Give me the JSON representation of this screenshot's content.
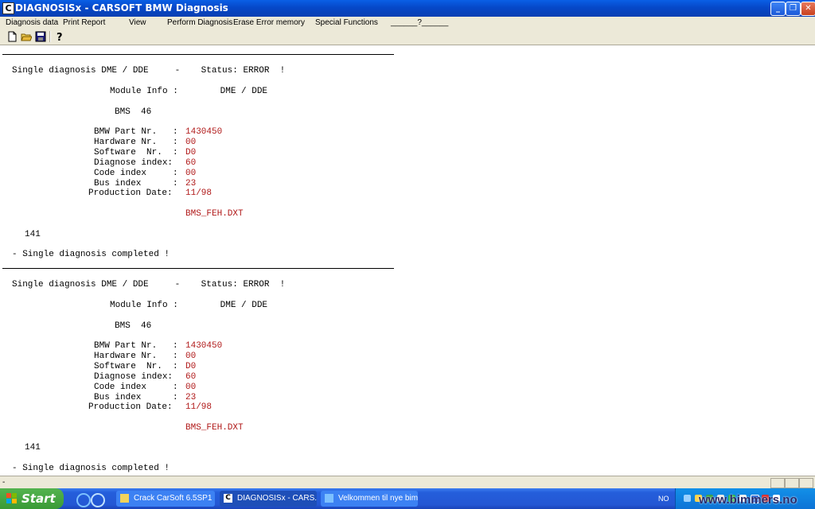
{
  "window": {
    "title": "DIAGNOSISx - CARSOFT BMW Diagnosis",
    "icon_letter": "C"
  },
  "menu": {
    "items": [
      "Diagnosis data",
      "Print Report",
      "View",
      "Perform Diagnosis",
      "Erase Error memory",
      "Special Functions",
      "______?______"
    ]
  },
  "toolbar": {
    "icons": [
      "new-file-icon",
      "open-folder-icon",
      "save-disk-icon",
      "help-icon"
    ]
  },
  "report": {
    "blocks": [
      {
        "header": "Single diagnosis DME / DDE     -    Status: ERROR  !",
        "module_info": "Module Info :        DME / DDE",
        "module_name": "BMS  46",
        "fields": [
          {
            "label": "BMW Part Nr.   :",
            "value": "1430450"
          },
          {
            "label": "Hardware Nr.   :",
            "value": "00"
          },
          {
            "label": "Software  Nr.  :",
            "value": "D0"
          },
          {
            "label": "Diagnose index:",
            "value": "60"
          },
          {
            "label": "Code index     :",
            "value": "00"
          },
          {
            "label": "Bus index      :",
            "value": "23"
          },
          {
            "label": "Production Date:",
            "value": "11/98"
          }
        ],
        "file": "BMS_FEH.DXT",
        "count": "141",
        "footer": "- Single diagnosis completed !"
      },
      {
        "header": "Single diagnosis DME / DDE     -    Status: ERROR  !",
        "module_info": "Module Info :        DME / DDE",
        "module_name": "BMS  46",
        "fields": [
          {
            "label": "BMW Part Nr.   :",
            "value": "1430450"
          },
          {
            "label": "Hardware Nr.   :",
            "value": "00"
          },
          {
            "label": "Software  Nr.  :",
            "value": "D0"
          },
          {
            "label": "Diagnose index:",
            "value": "60"
          },
          {
            "label": "Code index     :",
            "value": "00"
          },
          {
            "label": "Bus index      :",
            "value": "23"
          },
          {
            "label": "Production Date:",
            "value": "11/98"
          }
        ],
        "file": "BMS_FEH.DXT",
        "count": "141",
        "footer": "- Single diagnosis completed !"
      }
    ]
  },
  "statusbar": {
    "text": "-"
  },
  "taskbar": {
    "start_label": "Start",
    "tasks": [
      {
        "label": "Crack CarSoft 6.5SP1",
        "icon": "folder-icon"
      },
      {
        "label": "DIAGNOSISx - CARS...",
        "icon": "carsoft-icon",
        "icon_letter": "C",
        "active": true
      },
      {
        "label": "Velkommen til nye bim...",
        "icon": "browser-icon"
      }
    ],
    "tray_lang": "NO",
    "watermark": "www.bimmers.no"
  },
  "colors": {
    "accent_blue": "#0a5fe6",
    "value_red": "#b01818",
    "taskbar_green": "#3a9a36"
  }
}
